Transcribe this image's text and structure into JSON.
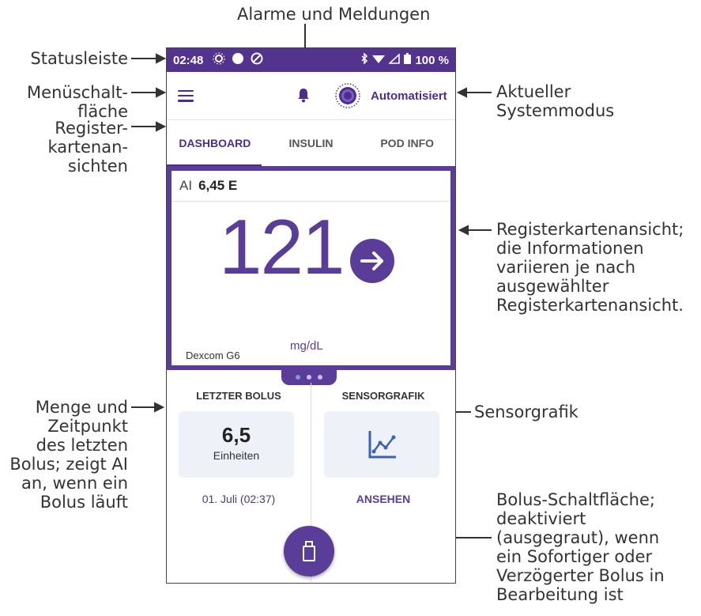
{
  "callouts": {
    "alarms": "Alarme und Meldungen",
    "statusbar": "Statusleiste",
    "menu": "Menüschalt-\nfläche",
    "tabs_views": "Register-\nkartenan-\nsichten",
    "system_mode": "Aktueller\nSystemmodus",
    "tab_view": "Registerkartenansicht;\ndie Informationen\nvariieren je nach\nausgewählter\nRegisterkartenansicht.",
    "last_bolus": "Menge und\nZeitpunkt\ndes letzten\nBolus; zeigt AI\nan, wenn ein\nBolus läuft",
    "sensor_graph": "Sensorgrafik",
    "bolus_button": "Bolus-Schaltfläche;\ndeaktiviert\n(ausgegraut), wenn\nein Sofortiger oder\nVerzögerter Bolus in\nBearbeitung ist"
  },
  "status": {
    "time": "02:48",
    "battery": "100 %"
  },
  "appbar": {
    "mode_label": "Automatisiert"
  },
  "tabs": [
    {
      "label": "DASHBOARD",
      "active": true
    },
    {
      "label": "INSULIN",
      "active": false
    },
    {
      "label": "POD INFO",
      "active": false
    }
  ],
  "dashboard": {
    "iob_label": "AI",
    "iob_value": "6,45 E",
    "glucose_value": "121",
    "glucose_unit": "mg/dL",
    "trend_icon": "arrow-right-icon",
    "sensor_name": "Dexcom G6",
    "page_indicator": {
      "pages": 3,
      "active": 0
    }
  },
  "last_bolus": {
    "header": "LETZTER BOLUS",
    "amount": "6,5",
    "unit": "Einheiten",
    "datetime": "01. Juli (02:37)"
  },
  "sensor_graph": {
    "header": "SENSORGRAFIK",
    "link": "ANSEHEN"
  },
  "colors": {
    "brand": "#5a3d99",
    "statusbar": "#54338f",
    "box_bg": "#eef2f8"
  }
}
